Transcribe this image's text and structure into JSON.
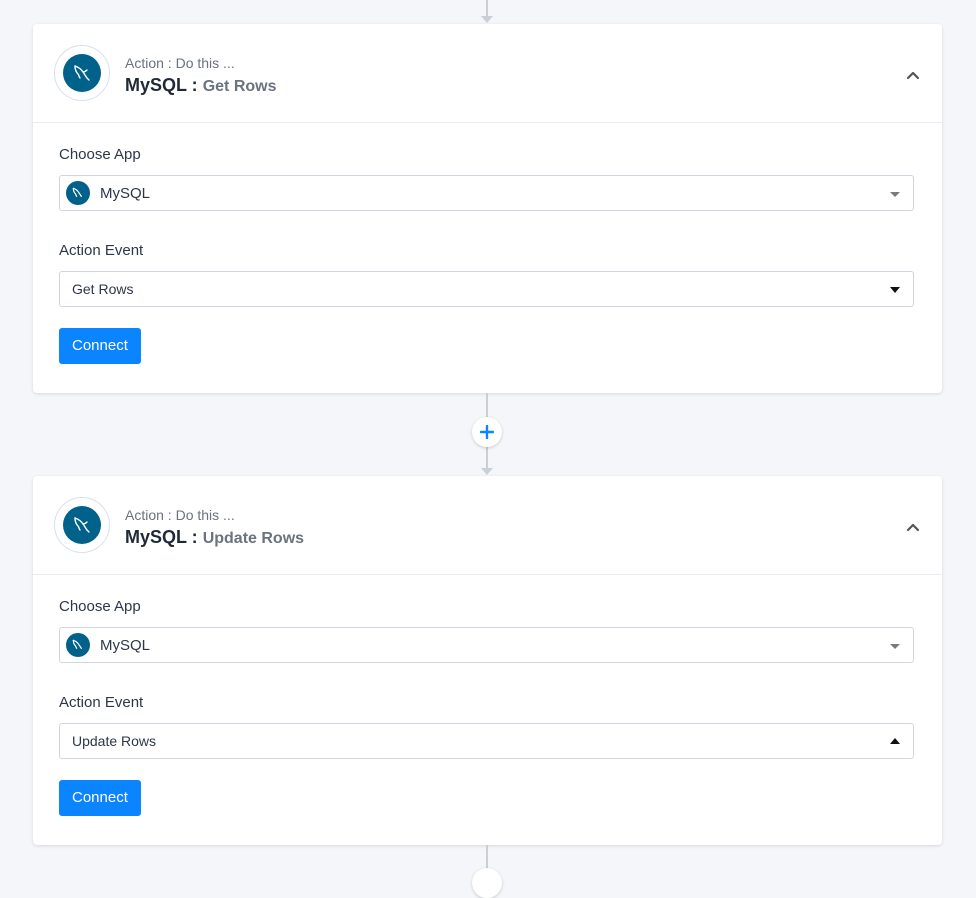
{
  "steps": [
    {
      "header_sub": "Action : Do this ...",
      "app_title": "MySQL :",
      "event_title": "Get Rows",
      "choose_app_label": "Choose App",
      "app_value": "MySQL",
      "action_event_label": "Action Event",
      "event_value": "Get Rows",
      "connect_label": "Connect"
    },
    {
      "header_sub": "Action : Do this ...",
      "app_title": "MySQL :",
      "event_title": "Update Rows",
      "choose_app_label": "Choose App",
      "app_value": "MySQL",
      "action_event_label": "Action Event",
      "event_value": "Update Rows",
      "connect_label": "Connect"
    }
  ],
  "colors": {
    "accent": "#0b84ff",
    "mysql_brand": "#00618a",
    "background": "#f4f6f9"
  },
  "icons": {
    "app": "mysql-dolphin-icon",
    "collapse": "chevron-up-icon",
    "add": "plus-icon"
  }
}
